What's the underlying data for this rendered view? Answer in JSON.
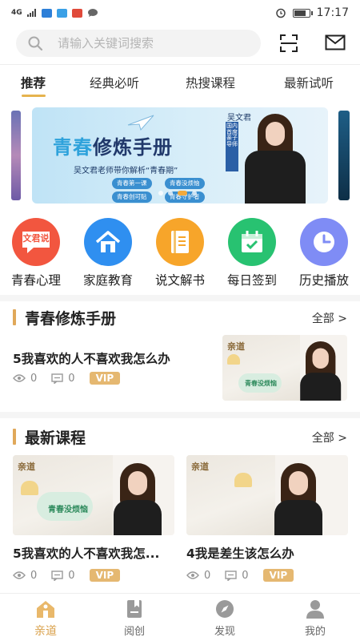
{
  "status_bar": {
    "signal": "4G",
    "time": "17:17"
  },
  "search": {
    "placeholder": "请输入关键词搜索"
  },
  "tabs": [
    {
      "label": "推荐",
      "active": true
    },
    {
      "label": "经典必听",
      "active": false
    },
    {
      "label": "热搜课程",
      "active": false
    },
    {
      "label": "最新试听",
      "active": false
    }
  ],
  "banner": {
    "title_part1": "青春",
    "title_part2": "修炼手册",
    "subtitle": "吴文君老师带你解析“青春期”",
    "name": "吴文君",
    "tagline": "国内首席亲子导师",
    "pills": [
      "青春第一课",
      "青春没烦恼",
      "青春创可贴",
      "青春守护者"
    ]
  },
  "quick_entries": [
    {
      "label": "青春心理",
      "icon": "wenjunshuo-chat-icon",
      "badge_text": "文君说",
      "color": "#f2563f"
    },
    {
      "label": "家庭教育",
      "icon": "house-icon",
      "color": "#2f8ff0"
    },
    {
      "label": "说文解书",
      "icon": "book-icon",
      "color": "#f7a52a"
    },
    {
      "label": "每日签到",
      "icon": "calendar-check-icon",
      "color": "#28c271"
    },
    {
      "label": "历史播放",
      "icon": "clock-icon",
      "color": "#7f8cf5"
    }
  ],
  "section1": {
    "title": "青春修炼手册",
    "more": "全部 >",
    "course": {
      "title": "5我喜欢的人不喜欢我怎么办",
      "views": "0",
      "comments": "0",
      "badge": "VIP",
      "thumb_tag": "亲道",
      "thumb_text": "青春没烦恼"
    }
  },
  "section2": {
    "title": "最新课程",
    "more": "全部 >",
    "courses": [
      {
        "title": "5我喜欢的人不喜欢我怎...",
        "views": "0",
        "comments": "0",
        "badge": "VIP",
        "thumb_tag": "亲道",
        "thumb_text": "青春没烦恼"
      },
      {
        "title": "4我是差生该怎么办",
        "views": "0",
        "comments": "0",
        "badge": "VIP",
        "thumb_tag": "亲道"
      }
    ]
  },
  "bottom_nav": [
    {
      "label": "亲道",
      "icon": "home-icon",
      "active": true
    },
    {
      "label": "阅创",
      "icon": "bookmark-book-icon",
      "active": false
    },
    {
      "label": "发现",
      "icon": "compass-icon",
      "active": false
    },
    {
      "label": "我的",
      "icon": "person-icon",
      "active": false
    }
  ],
  "colors": {
    "accent": "#e0a85a",
    "vip": "#e5b871",
    "nav_active": "#d9a04a"
  }
}
